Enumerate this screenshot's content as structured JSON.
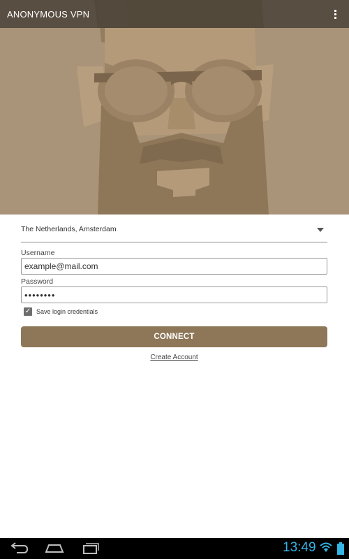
{
  "header": {
    "app_title": "ANONYMOUS VPN",
    "overflow_icon": "overflow-menu-icon"
  },
  "hero": {
    "illustration": "bearded-man-with-sunglasses-illustration"
  },
  "form": {
    "server_value": "The Netherlands, Amsterdam",
    "username_label": "Username",
    "username_value": "example@mail.com",
    "password_label": "Password",
    "password_value": "••••••••",
    "save_credentials_label": "Save login credentials",
    "save_credentials_checked": true,
    "connect_label": "CONNECT",
    "create_account_label": "Create Account"
  },
  "system_bar": {
    "time": "13:49",
    "icons": [
      "back-icon",
      "home-icon",
      "recent-apps-icon",
      "wifi-icon",
      "battery-icon"
    ]
  },
  "colors": {
    "accent": "#8e7758",
    "hero_background": "#a99479",
    "clock": "#33b5e5"
  }
}
